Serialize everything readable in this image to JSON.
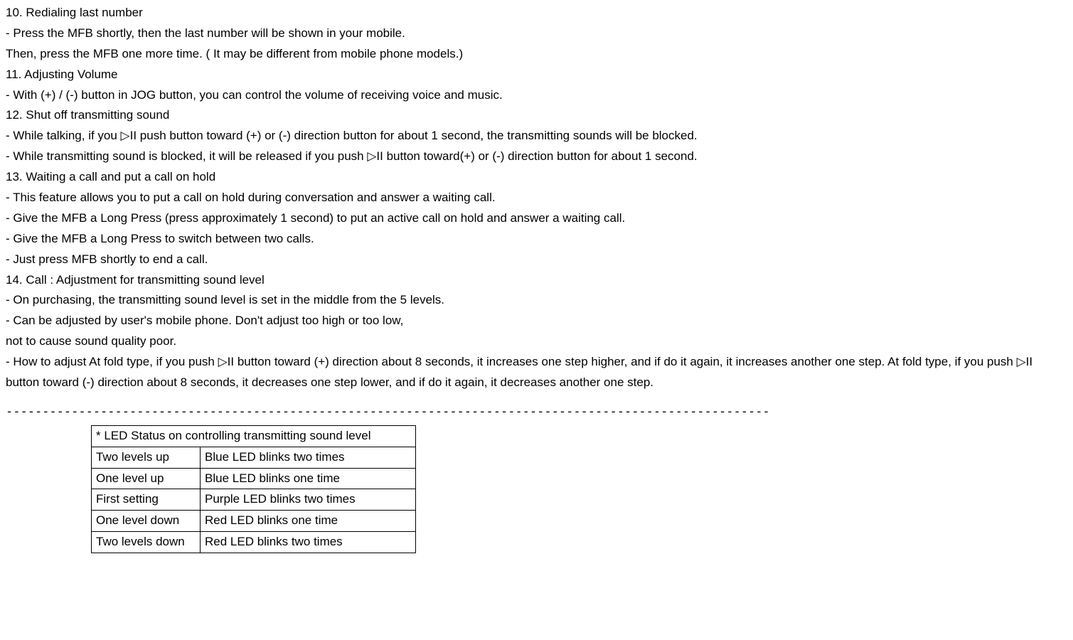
{
  "lines": {
    "l1": "10. Redialing last number",
    "l2": "- Press the MFB shortly, then the last number will be shown in your mobile.",
    "l3": "Then, press the MFB one more time. ( It may be different from mobile phone models.)",
    "l4": "11. Adjusting Volume",
    "l5": "- With (+) / (-) button in JOG button, you can control the volume of receiving voice and music.",
    "l6": "12. Shut off transmitting sound",
    "l7": "- While talking, if you ▷II push button toward (+) or (-) direction button for about 1 second, the transmitting sounds will be blocked.",
    "l8": "- While transmitting sound is blocked, it will be released if you push ▷II button toward(+) or (-) direction button for about 1 second.",
    "l9": "13. Waiting a call and put a call on hold",
    "l10": "- This feature allows you to put a call on hold during conversation and answer a waiting call.",
    "l11": "- Give the MFB a Long Press (press approximately 1 second) to put an active call on hold and answer a waiting call.",
    "l12": "- Give the MFB a Long Press to switch between two calls.",
    "l13": "- Just press MFB shortly to end a call.",
    "l14": "14. Call : Adjustment for transmitting sound level",
    "l15": "- On purchasing, the transmitting sound level is set in the middle from the 5 levels.",
    "l16": "- Can be adjusted by user's mobile phone. Don't adjust too high or too low,",
    "l17": "not to cause sound quality poor.",
    "l18": "- How to adjust At fold type, if you push ▷II button toward (+) direction about 8 seconds, it increases one step higher, and if do it again, it increases another one step. At fold type, if you push ▷II button toward (-) direction about 8 seconds, it decreases one step lower, and if do it again, it decreases another one step."
  },
  "separator": "---------------------------------------------------------------------------------------------------------",
  "table": {
    "header": "* LED Status on controlling transmitting sound level",
    "rows": [
      {
        "level": "Two levels up",
        "desc": "Blue LED blinks two times"
      },
      {
        "level": "One level up",
        "desc": "Blue LED blinks one time"
      },
      {
        "level": "First setting",
        "desc": "Purple LED blinks two times"
      },
      {
        "level": "One level down",
        "desc": "Red LED blinks one time"
      },
      {
        "level": "Two levels down",
        "desc": "Red LED blinks two times"
      }
    ]
  }
}
